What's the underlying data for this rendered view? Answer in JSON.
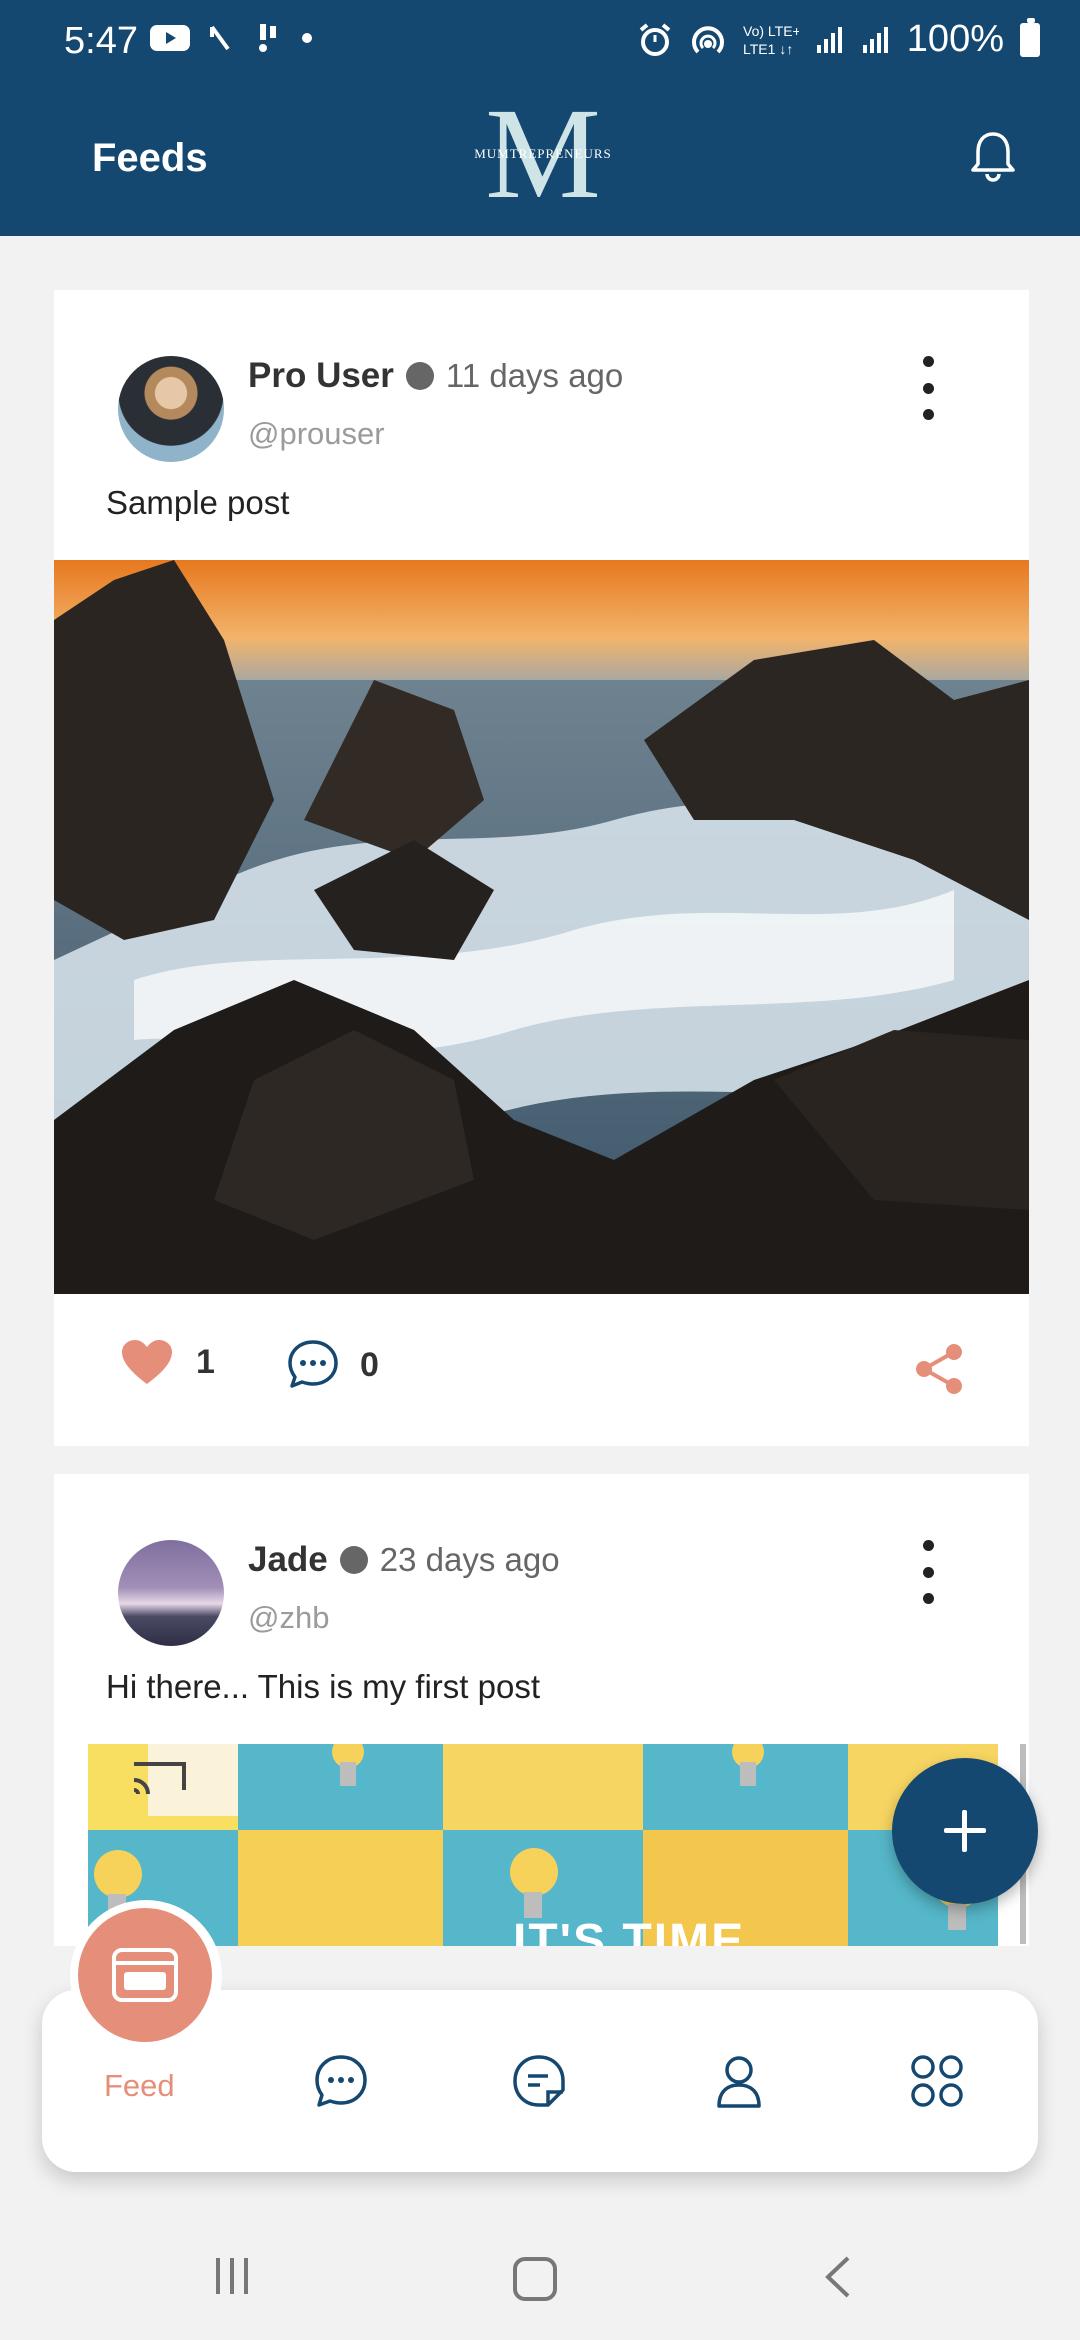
{
  "status_bar": {
    "time": "5:47",
    "battery": "100%",
    "network": "Vo) LTE+ LTE1"
  },
  "header": {
    "title": "Feeds",
    "logo_text": "MUMTREPRENEURS",
    "logo_letter": "M"
  },
  "posts": [
    {
      "name": "Pro User",
      "time_ago": "11 days ago",
      "handle": "@prouser",
      "text": "Sample post",
      "likes": "1",
      "comments": "0"
    },
    {
      "name": "Jade",
      "time_ago": "23 days ago",
      "handle": "@zhb",
      "text": "Hi there... This is my first post",
      "image_text": "IT'S TIME"
    }
  ],
  "bottom_nav": {
    "active_label": "Feed",
    "items": [
      "feed",
      "chat",
      "notes",
      "profile",
      "apps"
    ]
  },
  "colors": {
    "primary": "#154870",
    "accent": "#e58f7a",
    "background": "#f2f2f2"
  }
}
